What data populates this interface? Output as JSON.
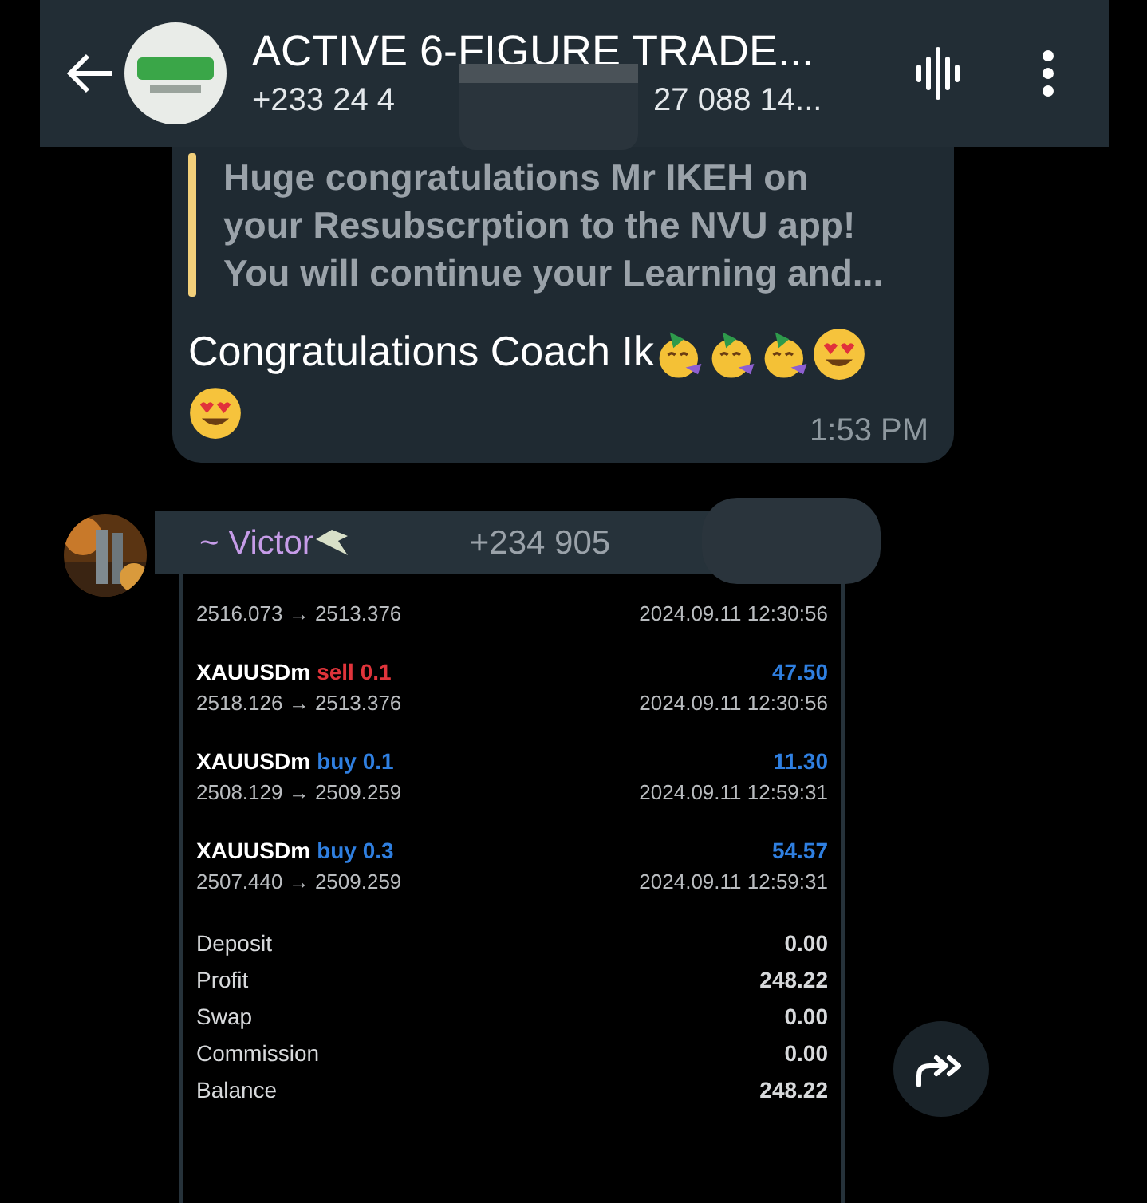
{
  "header": {
    "title": "ACTIVE 6-FIGURE TRADE...",
    "subtitle_start": "+233 24 4",
    "subtitle_end": "27 088 14..."
  },
  "messages": [
    {
      "kind": "reply",
      "quote": "Huge congratulations Mr IKEH on your Resubscrption to the NVU app! You will continue your Learning and...",
      "text": "Congratulations Coach Ik",
      "emoji": [
        {
          "kind": "party"
        },
        {
          "kind": "party"
        },
        {
          "kind": "party"
        },
        {
          "kind": "heart_eyes"
        },
        {
          "kind": "heart_eyes"
        }
      ],
      "time": "1:53 PM"
    },
    {
      "sender": "~ Victor",
      "phone": "+234 905",
      "trades": [
        {
          "prices": "2516.073 → 2513.376",
          "time": "2024.09.11 12:30:56"
        },
        {
          "symbol": "XAUUSDm",
          "side": "sell",
          "volume": "0.1",
          "color": "#e0343b",
          "profit": "47.50",
          "prices": "2518.126 → 2513.376",
          "time": "2024.09.11 12:30:56"
        },
        {
          "symbol": "XAUUSDm",
          "side": "buy",
          "volume": "0.1",
          "color": "#2f7fe0",
          "profit": "11.30",
          "prices": "2508.129 → 2509.259",
          "time": "2024.09.11 12:59:31"
        },
        {
          "symbol": "XAUUSDm",
          "side": "buy",
          "volume": "0.3",
          "color": "#2f7fe0",
          "profit": "54.57",
          "prices": "2507.440 → 2509.259",
          "time": "2024.09.11 12:59:31"
        }
      ],
      "summary": [
        {
          "label": "Deposit",
          "value": "0.00"
        },
        {
          "label": "Profit",
          "value": "248.22"
        },
        {
          "label": "Swap",
          "value": "0.00"
        },
        {
          "label": "Commission",
          "value": "0.00"
        },
        {
          "label": "Balance",
          "value": "248.22"
        }
      ]
    }
  ]
}
